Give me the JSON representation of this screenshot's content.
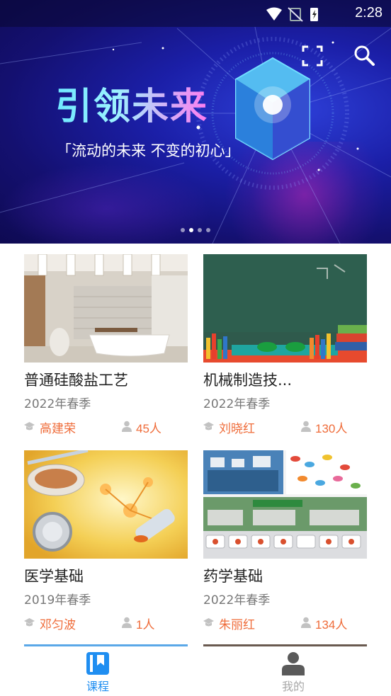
{
  "status_bar": {
    "time": "2:28"
  },
  "banner": {
    "title": "引领未来",
    "subtitle": "「流动的未来 不变的初心」",
    "dots": 4,
    "active_dot": 1
  },
  "courses": [
    {
      "title": "普通硅酸盐工艺",
      "term": "2022年春季",
      "teacher": "高建荣",
      "count": "45人"
    },
    {
      "title": "机械制造技...",
      "term": "2022年春季",
      "teacher": "刘晓红",
      "count": "130人"
    },
    {
      "title": "医学基础",
      "term": "2019年春季",
      "teacher": "邓匀波",
      "count": "1人"
    },
    {
      "title": "药学基础",
      "term": "2022年春季",
      "teacher": "朱丽红",
      "count": "134人"
    }
  ],
  "nav": {
    "courses_label": "课程",
    "mine_label": "我的"
  },
  "colors": {
    "accent": "#1f8ef1",
    "orange": "#ef6c3a",
    "banner_bg": "#1b1fa8"
  },
  "icons": [
    "fullscreen-icon",
    "search-icon",
    "graduation-cap-icon",
    "person-icon",
    "book-icon",
    "user-icon"
  ]
}
